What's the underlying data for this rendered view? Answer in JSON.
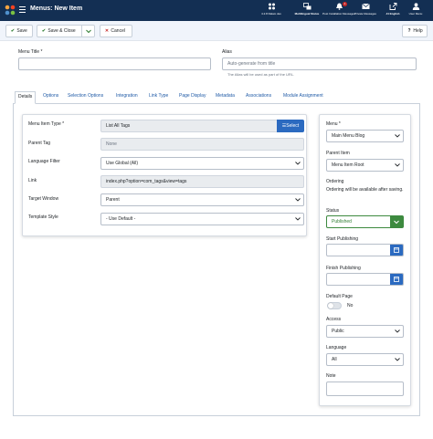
{
  "header": {
    "title": "Menus: New Item",
    "items": [
      {
        "label": "4.2.8 Dalam dev",
        "icon": "joomla-icon"
      },
      {
        "label": "Multilingual Status",
        "icon": "language-icon"
      },
      {
        "label": "Post Installation Messages",
        "icon": "bell-icon",
        "badge": "1"
      },
      {
        "label": "Private Messages",
        "icon": "envelope-icon"
      },
      {
        "label": "J4 English",
        "icon": "external-link-icon"
      },
      {
        "label": "User Menu",
        "icon": "user-icon"
      }
    ]
  },
  "toolbar": {
    "save": "Save",
    "save_close": "Save & Close",
    "cancel": "Cancel",
    "help": "Help"
  },
  "form": {
    "menu_title_label": "Menu Title *",
    "menu_title_value": "",
    "alias_label": "Alias",
    "alias_placeholder": "Auto-generate from title",
    "alias_hint": "The Alias will be used as part of the URL."
  },
  "tabs": [
    {
      "label": "Details",
      "active": true
    },
    {
      "label": "Options"
    },
    {
      "label": "Selection Options"
    },
    {
      "label": "Integration"
    },
    {
      "label": "Link Type"
    },
    {
      "label": "Page Display"
    },
    {
      "label": "Metadata"
    },
    {
      "label": "Associations"
    },
    {
      "label": "Module Assignment"
    }
  ],
  "details": {
    "menu_item_type_label": "Menu Item Type *",
    "menu_item_type_value": "List All Tags",
    "select_button": "Select",
    "parent_tag_label": "Parent Tag",
    "parent_tag_value": "None",
    "language_filter_label": "Language Filter",
    "language_filter_value": "Use Global (All)",
    "link_label": "Link",
    "link_value": "index.php?option=com_tags&view=tags",
    "target_window_label": "Target Window",
    "target_window_value": "Parent",
    "template_style_label": "Template Style",
    "template_style_value": "- Use Default -"
  },
  "sidebar": {
    "menu_label": "Menu *",
    "menu_value": "Main Menu Blog",
    "parent_item_label": "Parent Item",
    "parent_item_value": "Menu Item Root",
    "ordering_label": "Ordering",
    "ordering_text": "Ordering will be available after saving.",
    "status_label": "Status",
    "status_value": "Published",
    "start_publishing_label": "Start Publishing",
    "finish_publishing_label": "Finish Publishing",
    "default_page_label": "Default Page",
    "default_page_value": "No",
    "access_label": "Access",
    "access_value": "Public",
    "language_label": "Language",
    "language_value": "All",
    "note_label": "Note"
  },
  "colors": {
    "header_bg": "#132f53",
    "primary": "#2b6ac0",
    "success": "#3d8a3f",
    "danger": "#c52827"
  }
}
